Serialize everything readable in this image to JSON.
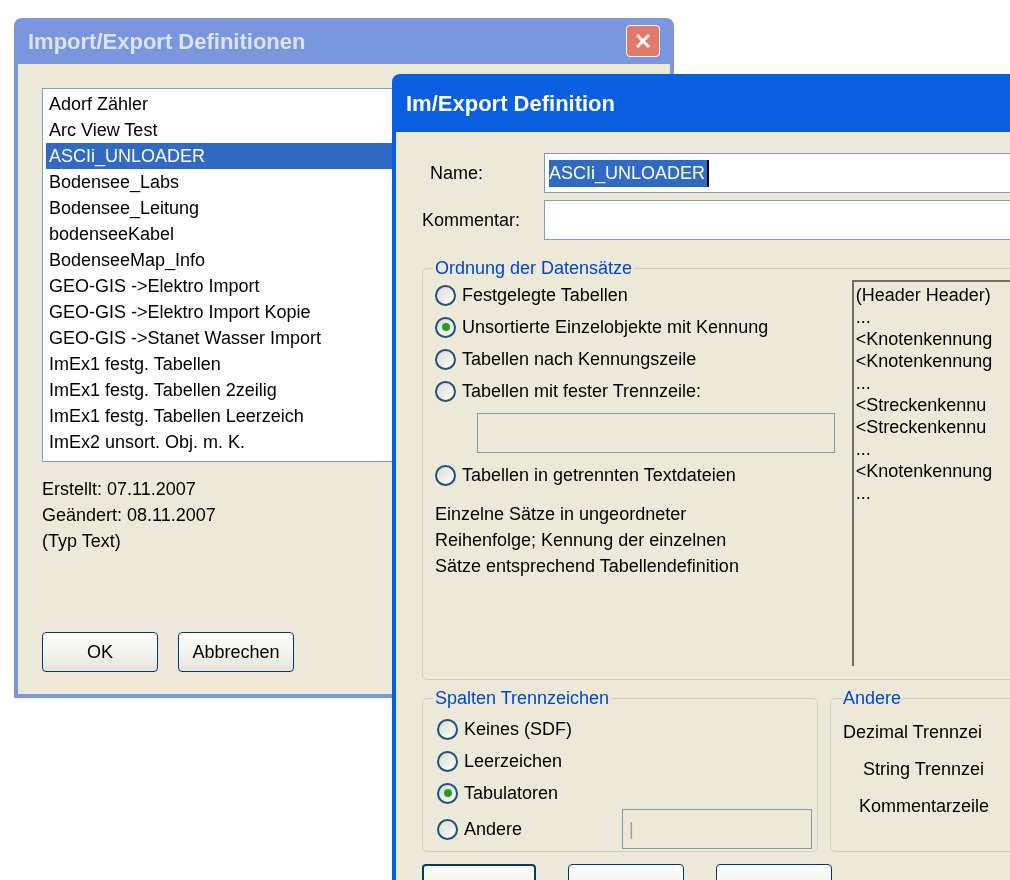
{
  "back_dialog": {
    "title": "Import/Export Definitionen",
    "active": false,
    "items": [
      {
        "label": "Adorf Zähler",
        "selected": false
      },
      {
        "label": "Arc View Test",
        "selected": false
      },
      {
        "label": "ASCIi_UNLOADER",
        "selected": true
      },
      {
        "label": "Bodensee_Labs",
        "selected": false
      },
      {
        "label": "Bodensee_Leitung",
        "selected": false
      },
      {
        "label": "bodenseeKabel",
        "selected": false
      },
      {
        "label": "BodenseeMap_Info",
        "selected": false
      },
      {
        "label": "GEO-GIS ->Elektro Import",
        "selected": false
      },
      {
        "label": "GEO-GIS ->Elektro Import Kopie",
        "selected": false
      },
      {
        "label": "GEO-GIS ->Stanet Wasser Import",
        "selected": false
      },
      {
        "label": "ImEx1 festg. Tabellen",
        "selected": false
      },
      {
        "label": "ImEx1 festg. Tabellen 2zeilig",
        "selected": false
      },
      {
        "label": "ImEx1 festg. Tabellen Leerzeich",
        "selected": false
      },
      {
        "label": "ImEx2 unsort. Obj. m. K.",
        "selected": false
      }
    ],
    "info": [
      "Erstellt: 07.11.2007",
      "Geändert: 08.11.2007",
      "(Typ Text)"
    ],
    "buttons": [
      "OK",
      "Abbrechen"
    ]
  },
  "front_dialog": {
    "title": "Im/Export Definition",
    "active": true,
    "name": {
      "label": "Name:",
      "value": "ASCIi_UNLOADER"
    },
    "comment": {
      "label": "Kommentar:"
    },
    "order_group": {
      "title": "Ordnung der Datensätze",
      "options": [
        {
          "label": "Festgelegte Tabellen",
          "selected": false
        },
        {
          "label": "Unsortierte Einzelobjekte mit Kennung",
          "selected": true
        },
        {
          "label": "Tabellen nach Kennungszeile",
          "selected": false
        },
        {
          "label": "Tabellen mit fester Trennzeile:",
          "selected": false
        },
        {
          "label": "Tabellen in getrennten Textdateien",
          "selected": false
        }
      ],
      "description": "Einzelne Sätze in ungeordneter Reihenfolge; Kennung der einzelnen Sätze entsprechend Tabellendefinition",
      "preview": [
        "(Header Header)",
        "...",
        "<Knotenkennung",
        "<Knotenkennung",
        "...",
        "<Streckenkennu",
        "<Streckenkennu",
        "...",
        "<Knotenkennung",
        "..."
      ]
    },
    "separator_group": {
      "title": "Spalten Trennzeichen",
      "options": [
        {
          "label": "Keines (SDF)",
          "selected": false
        },
        {
          "label": "Leerzeichen",
          "selected": false
        },
        {
          "label": "Tabulatoren",
          "selected": true
        },
        {
          "label": "Andere",
          "selected": false
        }
      ],
      "other_value": "|"
    },
    "other_group": {
      "title": "Andere",
      "labels": [
        "Dezimal Trennzei",
        "String Trennzei",
        "Kommentarzeile"
      ]
    }
  }
}
